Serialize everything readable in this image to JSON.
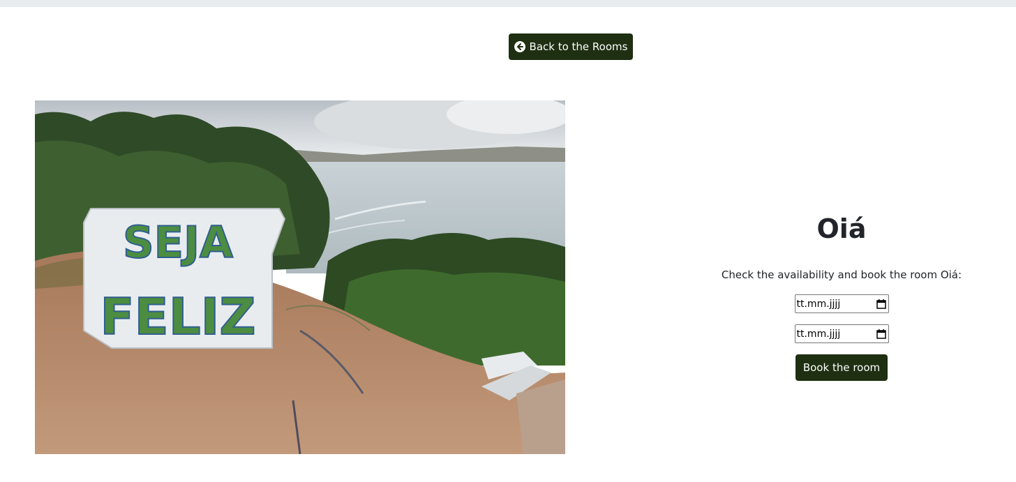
{
  "top_nav": {
    "back_button_label": "Back to the Rooms",
    "back_icon": "arrow-circle-left-icon"
  },
  "room": {
    "photo_sign_text_line1": "SEJA",
    "photo_sign_text_line2": "FELIZ",
    "title": "Oiá",
    "description": "Check the availability and book the room Oiá:",
    "checkin_date": {
      "placeholder": "tt.mm.jjjj",
      "icon": "calendar-icon"
    },
    "checkout_date": {
      "placeholder": "tt.mm.jjjj",
      "icon": "calendar-icon"
    },
    "book_button_label": "Book the room"
  },
  "colors": {
    "button_bg": "#1f2f12",
    "button_text": "#ffffff",
    "topbar": "#e9ecef"
  }
}
